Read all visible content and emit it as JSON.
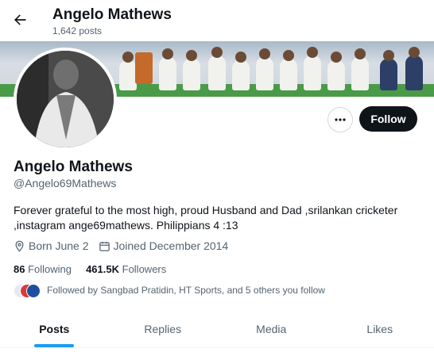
{
  "header": {
    "name": "Angelo Mathews",
    "posts_count": "1,642 posts"
  },
  "profile": {
    "name": "Angelo Mathews",
    "handle": "@Angelo69Mathews",
    "bio": "Forever grateful to the most high, proud Husband and Dad ,srilankan cricketer ,instagram ange69mathews. Philippians  4 :13",
    "born": "Born June 2",
    "joined": "Joined December 2014",
    "following_count": "86",
    "following_label": "Following",
    "followers_count": "461.5K",
    "followers_label": "Followers",
    "followed_by": "Followed by Sangbad Pratidin, HT Sports, and 5 others you follow"
  },
  "actions": {
    "follow_label": "Follow"
  },
  "tabs": [
    {
      "label": "Posts",
      "active": true
    },
    {
      "label": "Replies",
      "active": false
    },
    {
      "label": "Media",
      "active": false
    },
    {
      "label": "Likes",
      "active": false
    }
  ],
  "icons": {
    "back": "back-arrow-icon",
    "more": "more-horizontal-icon",
    "birthday": "location-pin-icon",
    "calendar": "calendar-icon"
  },
  "colors": {
    "accent": "#1d9bf0",
    "text": "#0f1419",
    "secondary_text": "#536471",
    "follow_button_bg": "#0f1419"
  }
}
